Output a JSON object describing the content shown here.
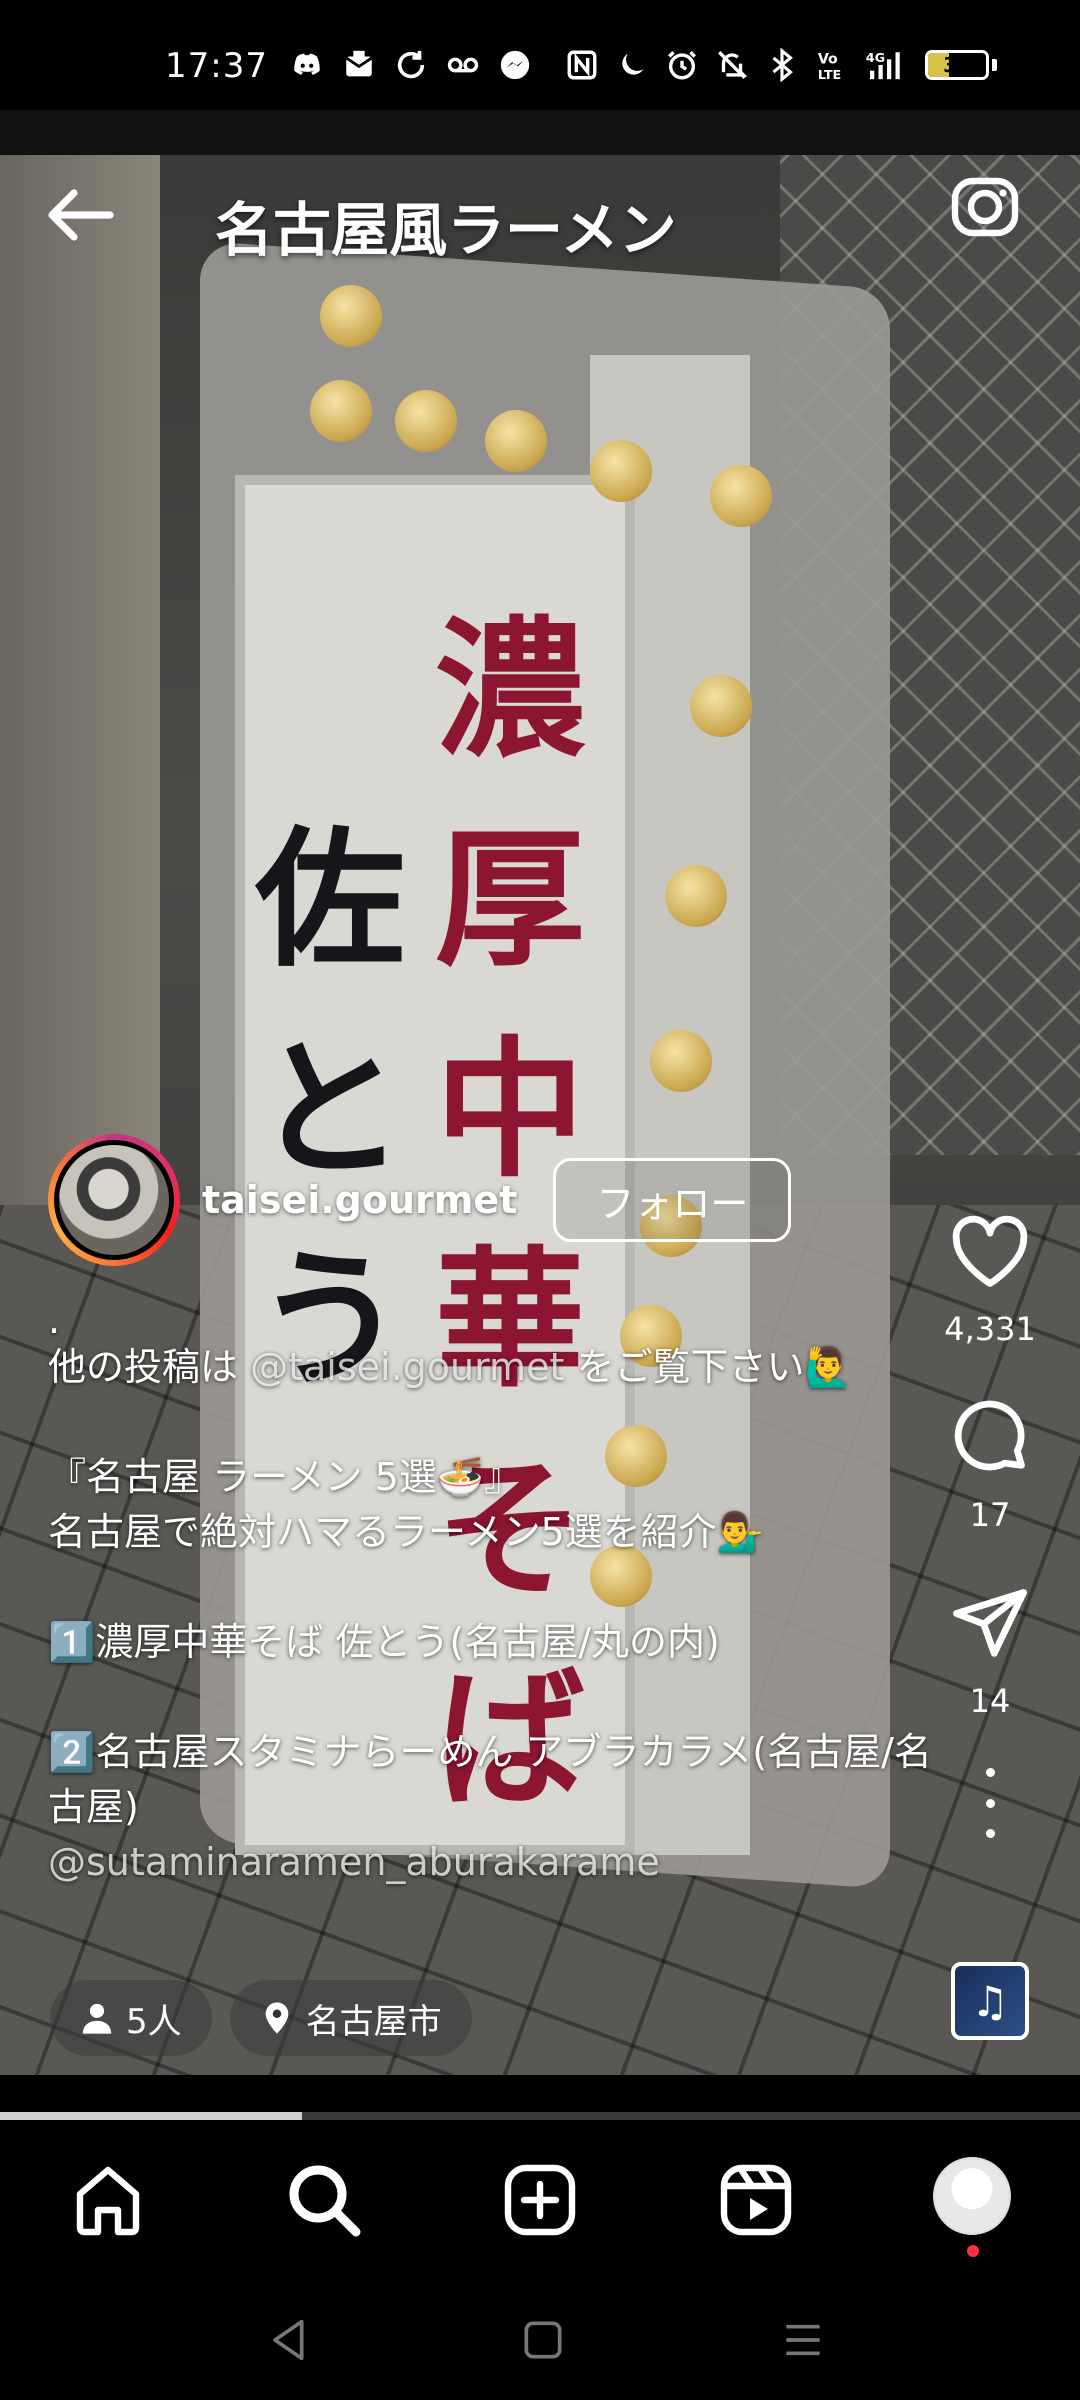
{
  "status_bar": {
    "time": "17:37",
    "left_icons": [
      "discord-icon",
      "mail-icon",
      "sync-icon",
      "voicemail-icon",
      "messenger-icon"
    ],
    "right_icons": [
      "nfc-icon",
      "moon-icon",
      "alarm-icon",
      "mute-icon",
      "bluetooth-icon",
      "volte-icon",
      "4g-signal-icon"
    ],
    "network": "4G",
    "battery": "36",
    "battery_level": 0.36,
    "battery_color": "#d8c14a"
  },
  "header": {
    "title": "名古屋風ラーメン",
    "back_icon": "arrow-left-icon",
    "camera_icon": "camera-icon"
  },
  "post": {
    "username": "taisei.gourmet",
    "follow_label": "フォロー",
    "caption": {
      "dot": ".",
      "line1_pre": "他の投稿は ",
      "line1_mention": "@taisei.gourmet",
      "line1_post": " をご覧下さい🙋‍♂️",
      "line2": "『名古屋 ラーメン 5選🍜』",
      "line3": "名古屋で絶対ハマるラーメン5選を紹介💁‍♂️",
      "line4": "1️⃣濃厚中華そば 佐とう(名古屋/丸の内)",
      "line5": "2️⃣名古屋スタミナらーめん アブラカラメ(名古屋/名古屋)",
      "line6_mention": "@sutaminaramen_aburakarame"
    },
    "chips": {
      "people": "5人",
      "location": "名古屋市"
    },
    "progress": 0.28
  },
  "sign_text": {
    "red": "濃厚中華そば",
    "black": "佐とう"
  },
  "actions": {
    "like_count": "4,331",
    "comment_count": "17",
    "share_count": "14",
    "audio_icon": "music-note-icon"
  },
  "bottom_nav": {
    "items": [
      "home-icon",
      "search-icon",
      "create-icon",
      "reels-icon",
      "profile-avatar"
    ],
    "notification_color": "#ff3040"
  },
  "system_nav": [
    "back-triangle-icon",
    "home-square-icon",
    "recents-menu-icon"
  ],
  "colors": {
    "background": "#000000",
    "text": "#ffffff",
    "follow_border": "#ffffff"
  }
}
